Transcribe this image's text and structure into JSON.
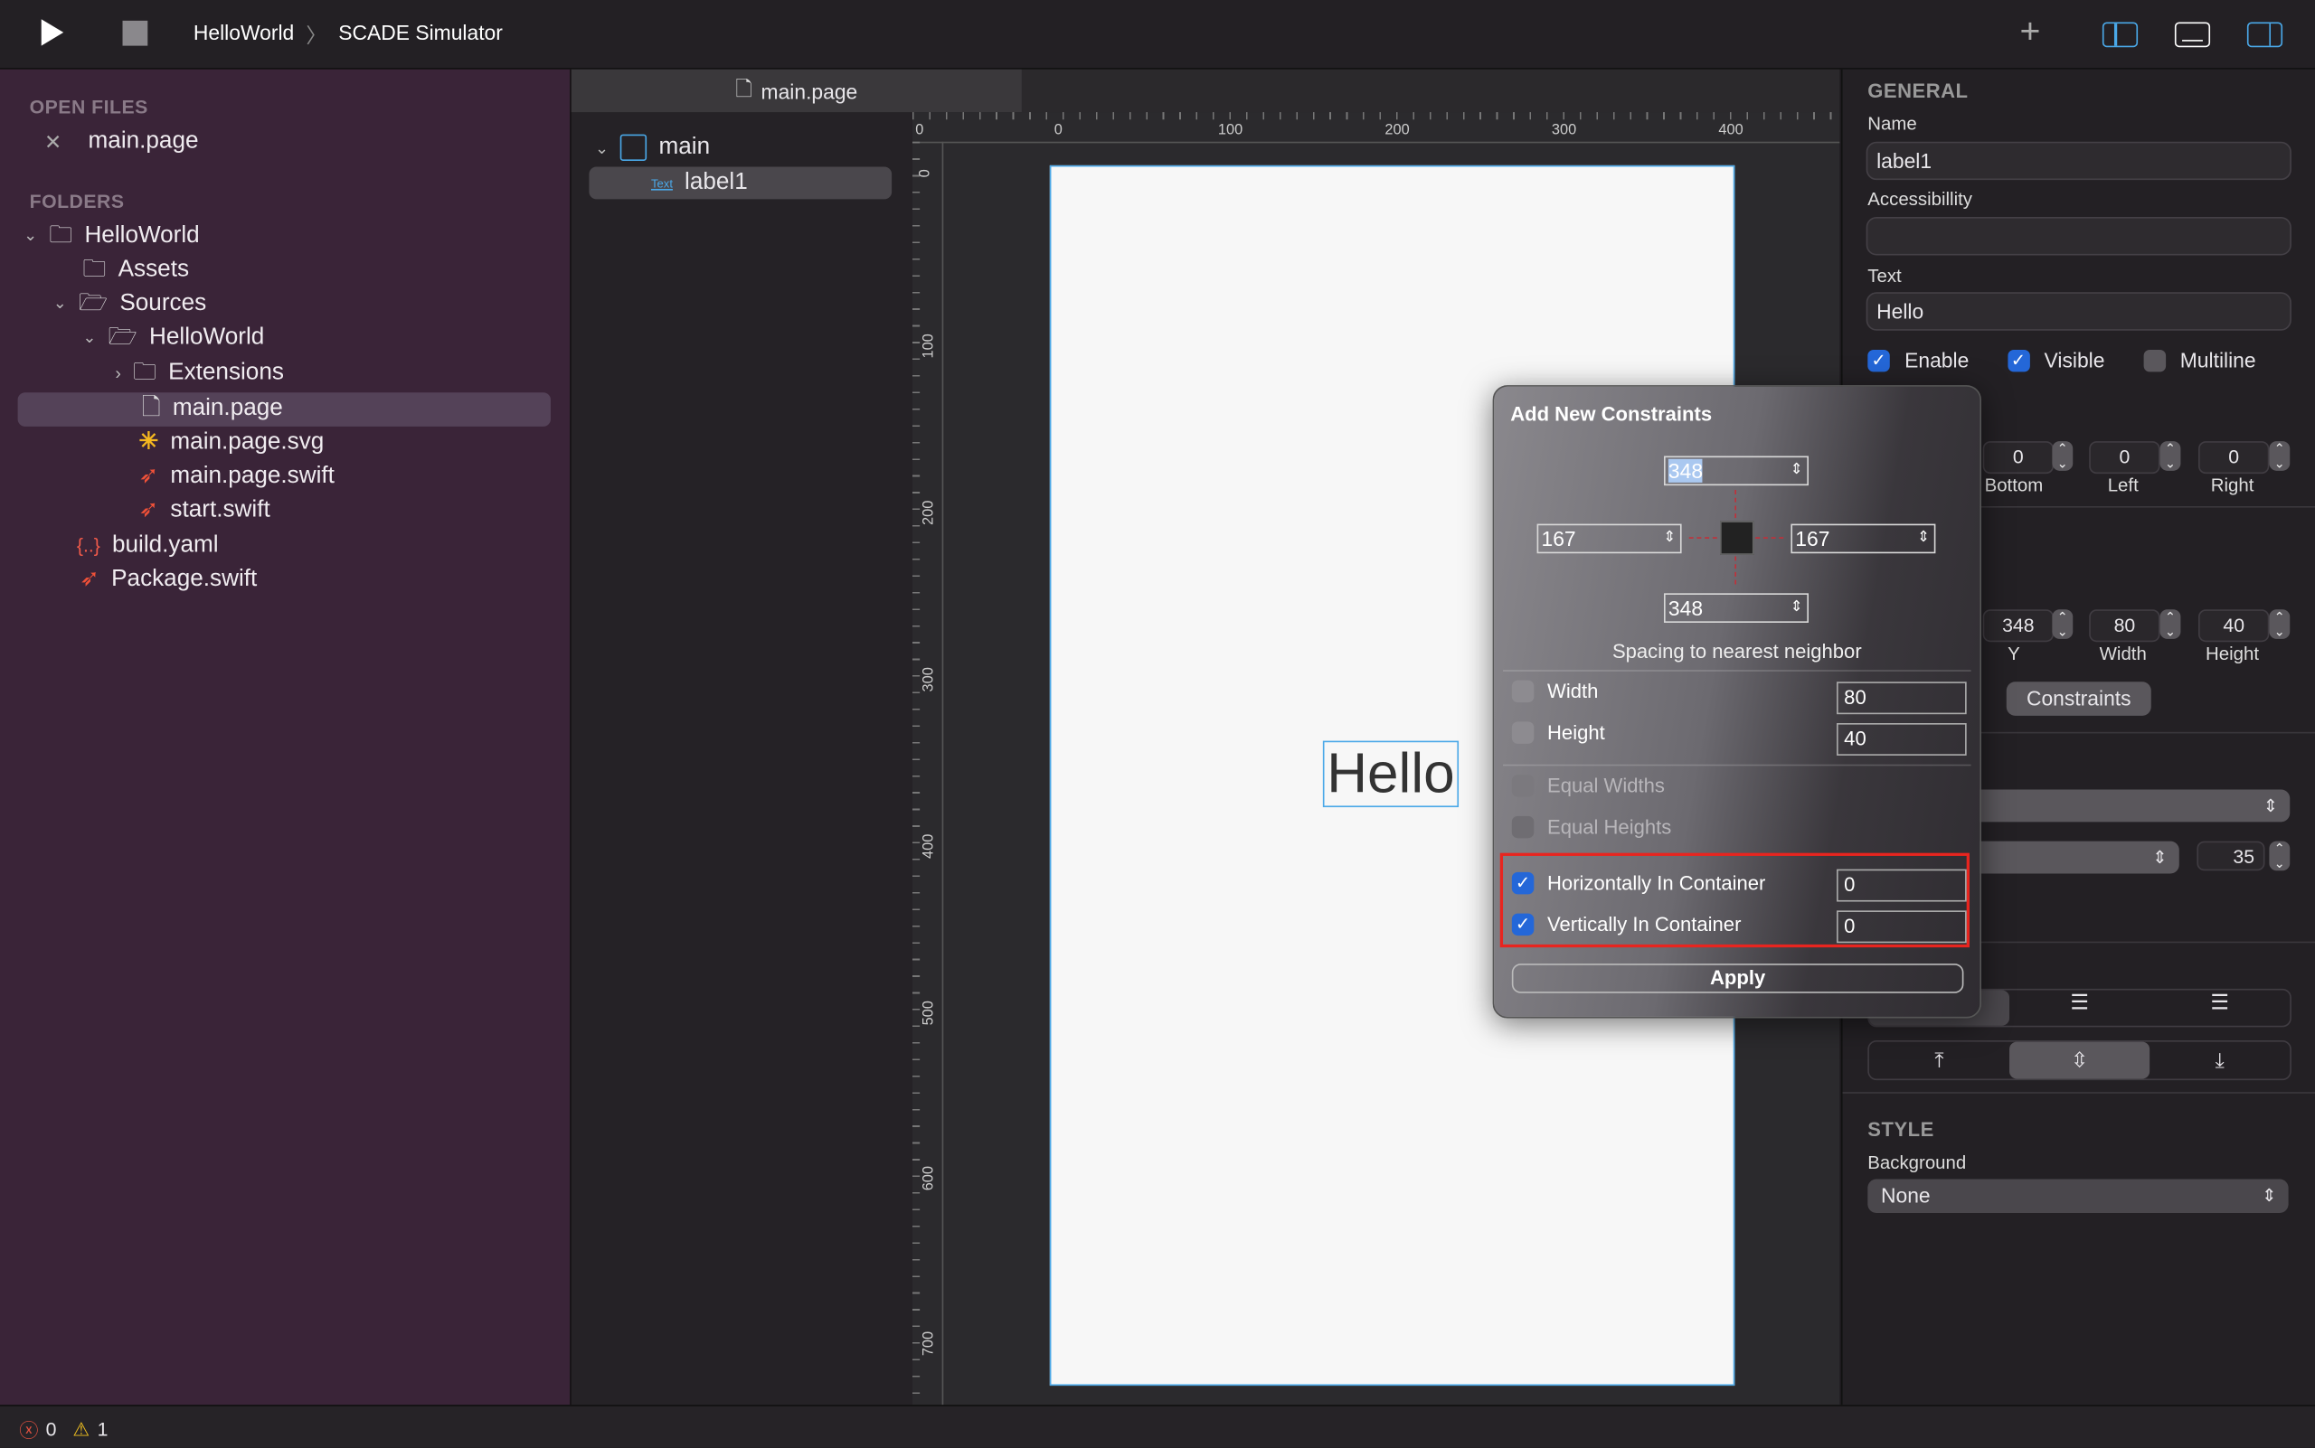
{
  "toolbar": {
    "breadcrumb": [
      "HelloWorld",
      "SCADE Simulator"
    ],
    "separator": "〉"
  },
  "sidebar": {
    "open_files_heading": "OPEN FILES",
    "open_files": [
      "main.page"
    ],
    "folders_heading": "FOLDERS",
    "tree": [
      {
        "label": "HelloWorld",
        "icon": "project-folder-icon",
        "expanded": true
      },
      {
        "label": "Assets",
        "icon": "folder-icon"
      },
      {
        "label": "Sources",
        "icon": "folder-open-icon",
        "expanded": true
      },
      {
        "label": "HelloWorld",
        "icon": "folder-open-icon",
        "expanded": true
      },
      {
        "label": "Extensions",
        "icon": "folder-icon",
        "expanded": false
      },
      {
        "label": "main.page",
        "icon": "file-icon",
        "selected": true
      },
      {
        "label": "main.page.svg",
        "icon": "svg-asterisk-icon"
      },
      {
        "label": "main.page.swift",
        "icon": "swift-icon"
      },
      {
        "label": "start.swift",
        "icon": "swift-icon"
      },
      {
        "label": "build.yaml",
        "icon": "yaml-braces-icon"
      },
      {
        "label": "Package.swift",
        "icon": "swift-icon"
      }
    ]
  },
  "editor": {
    "tab": "main.page"
  },
  "outline": {
    "root": "main",
    "child_badge": "Text",
    "child": "label1"
  },
  "ruler": {
    "top": [
      "0",
      "0",
      "100",
      "200",
      "300",
      "400"
    ],
    "left": [
      "0",
      "100",
      "200",
      "300",
      "400",
      "500",
      "600",
      "700"
    ]
  },
  "canvas": {
    "label_text": "Hello"
  },
  "popup": {
    "title": "Add New Constraints",
    "top": "348",
    "left": "167",
    "right": "167",
    "bottom": "348",
    "spacing_caption": "Spacing to nearest neighbor",
    "rows": [
      {
        "label": "Width",
        "checked": false,
        "value": "80",
        "enabled": true
      },
      {
        "label": "Height",
        "checked": false,
        "value": "40",
        "enabled": true
      },
      {
        "label": "Equal Widths",
        "checked": false,
        "enabled": false
      },
      {
        "label": "Equal Heights",
        "checked": false,
        "enabled": false
      },
      {
        "label": "Horizontally In Container",
        "checked": true,
        "value": "0",
        "enabled": true
      },
      {
        "label": "Vertically In Container",
        "checked": true,
        "value": "0",
        "enabled": true
      }
    ],
    "apply": "Apply",
    "highlight_color": "#e8251f"
  },
  "inspector": {
    "general_heading": "GENERAL",
    "name_label": "Name",
    "name_value": "label1",
    "accessibility_label": "Accessibillity",
    "accessibility_value": "",
    "text_label": "Text",
    "text_value": "Hello",
    "enable": "Enable",
    "visible": "Visible",
    "multiline": "Multiline",
    "margins": {
      "bottom": "0",
      "left": "0",
      "right": "0",
      "labels": [
        "Bottom",
        "Left",
        "Right"
      ]
    },
    "frame": {
      "y": "348",
      "width": "80",
      "height": "40",
      "labels": [
        "Y",
        "Width",
        "Height"
      ]
    },
    "constraints_button": "Constraints",
    "font_size": "35",
    "style_heading": "STYLE",
    "background_label": "Background",
    "background_value": "None"
  },
  "status": {
    "errors": "0",
    "warnings": "1"
  },
  "colors": {
    "accent": "#4aa8e8",
    "sidebar": "#3a2438",
    "checkbox": "#2467d8",
    "swift": "#f05138"
  }
}
